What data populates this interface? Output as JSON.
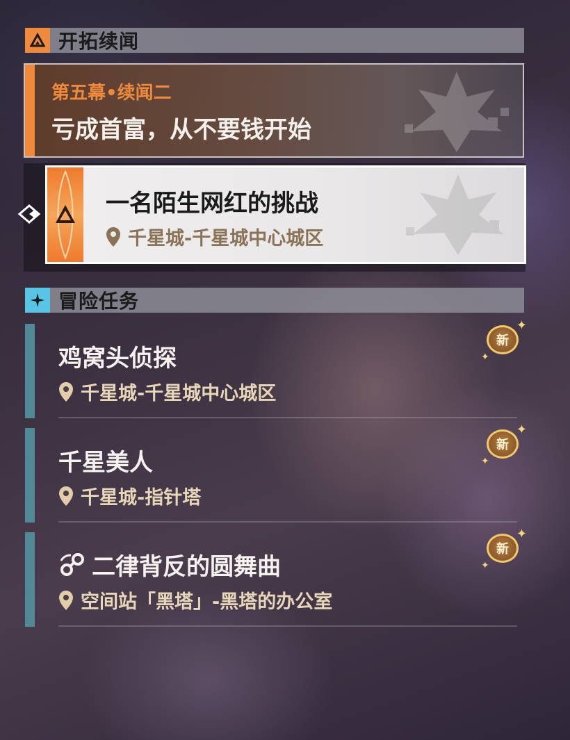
{
  "trailblaze_section": {
    "title": "开拓续闻",
    "icon": "trailblaze-triangle-icon",
    "accent_color": "#ef8a3c"
  },
  "chapter": {
    "label": "第五幕•续闻二",
    "title": "亏成首富，从不要钱开始"
  },
  "selected_quest": {
    "title": "一名陌生网红的挑战",
    "location": "千星城-千星城中心城区"
  },
  "adventure_section": {
    "title": "冒险任务",
    "icon": "sparkle-icon",
    "accent_color": "#56c6e4"
  },
  "adventure_quests": [
    {
      "title": "鸡窝头侦探",
      "location": "千星城-千星城中心城区",
      "badge": "新"
    },
    {
      "title": "千星美人",
      "location": "千星城-指针塔",
      "badge": "新"
    },
    {
      "title": "二律背反的圆舞曲",
      "location": "空间站「黑塔」-黑塔的办公室",
      "badge": "新",
      "title_icon": "orbit-node-icon"
    }
  ]
}
